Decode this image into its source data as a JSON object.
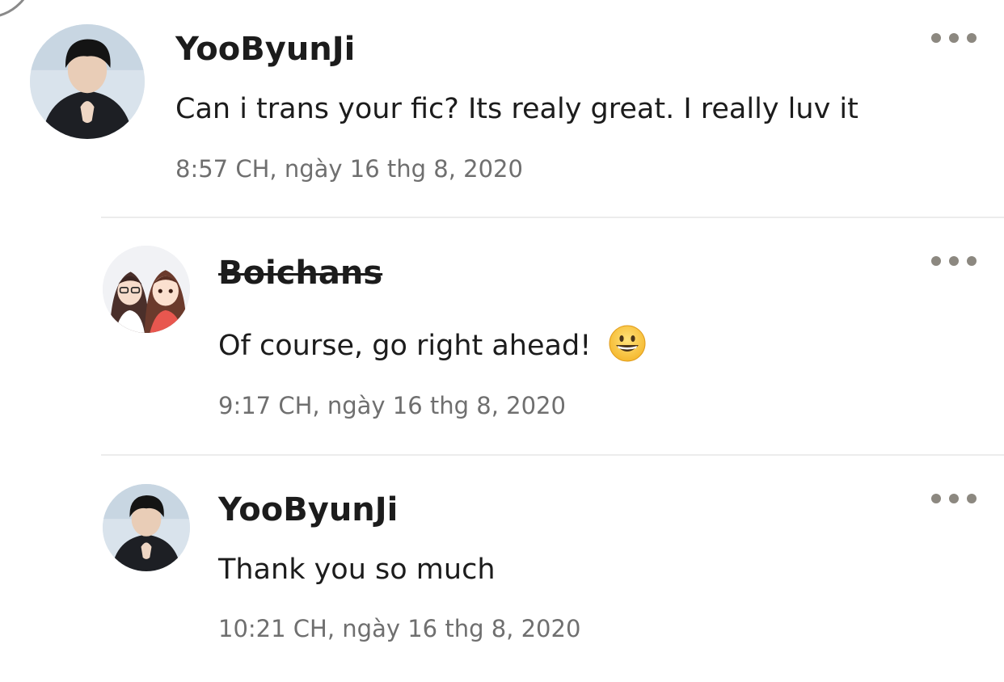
{
  "comments": [
    {
      "username": "YooByunJi",
      "message": "Can i trans your fic? Its realy great. I really luv it",
      "timestamp": "8:57 CH, ngày 16 thg 8, 2020",
      "struck_username": false,
      "avatar": "user-photo-avatar"
    },
    {
      "username": "Boichans",
      "message": "Of course, go right ahead!",
      "emoji": "grinning-face-emoji",
      "timestamp": "9:17 CH, ngày 16 thg 8, 2020",
      "struck_username": true,
      "avatar": "anime-girls-avatar"
    },
    {
      "username": "YooByunJi",
      "message": "Thank you so much",
      "timestamp": "10:21 CH, ngày 16 thg 8, 2020",
      "struck_username": false,
      "avatar": "user-photo-avatar"
    }
  ],
  "colors": {
    "text": "#1c1c1c",
    "timestamp": "#6f6f6f",
    "dots": "#8c8880",
    "divider": "#ececec"
  }
}
